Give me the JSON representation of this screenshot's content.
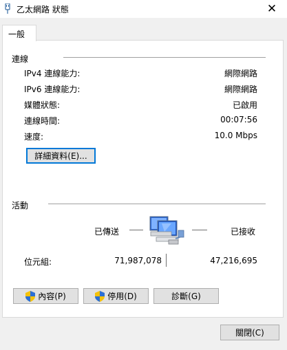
{
  "window": {
    "title": "乙太網路 狀態",
    "close_glyph": "✕",
    "icon": "network-plug-icon"
  },
  "tabs": [
    {
      "label": "一般"
    }
  ],
  "connection": {
    "group_label": "連線",
    "rows": [
      {
        "label": "IPv4 連線能力:",
        "value": "網際網路"
      },
      {
        "label": "IPv6 連線能力:",
        "value": "網際網路"
      },
      {
        "label": "媒體狀態:",
        "value": "已啟用"
      },
      {
        "label": "連線時間:",
        "value": "00:07:56"
      },
      {
        "label": "速度:",
        "value": "10.0 Mbps"
      }
    ],
    "details_button": "詳細資料(E)..."
  },
  "activity": {
    "group_label": "活動",
    "sent_label": "已傳送",
    "received_label": "已接收",
    "bytes_label": "位元組:",
    "bytes_sent": "71,987,078",
    "bytes_received": "47,216,695",
    "icon": "network-computers-icon"
  },
  "buttons": {
    "properties": "內容(P)",
    "disable": "停用(D)",
    "diagnose": "診斷(G)",
    "close": "關閉(C)"
  },
  "colors": {
    "accent": "#0078d7",
    "panel_bg": "#ffffff",
    "window_bg": "#f0f0f0",
    "button_bg": "#e1e1e1"
  }
}
